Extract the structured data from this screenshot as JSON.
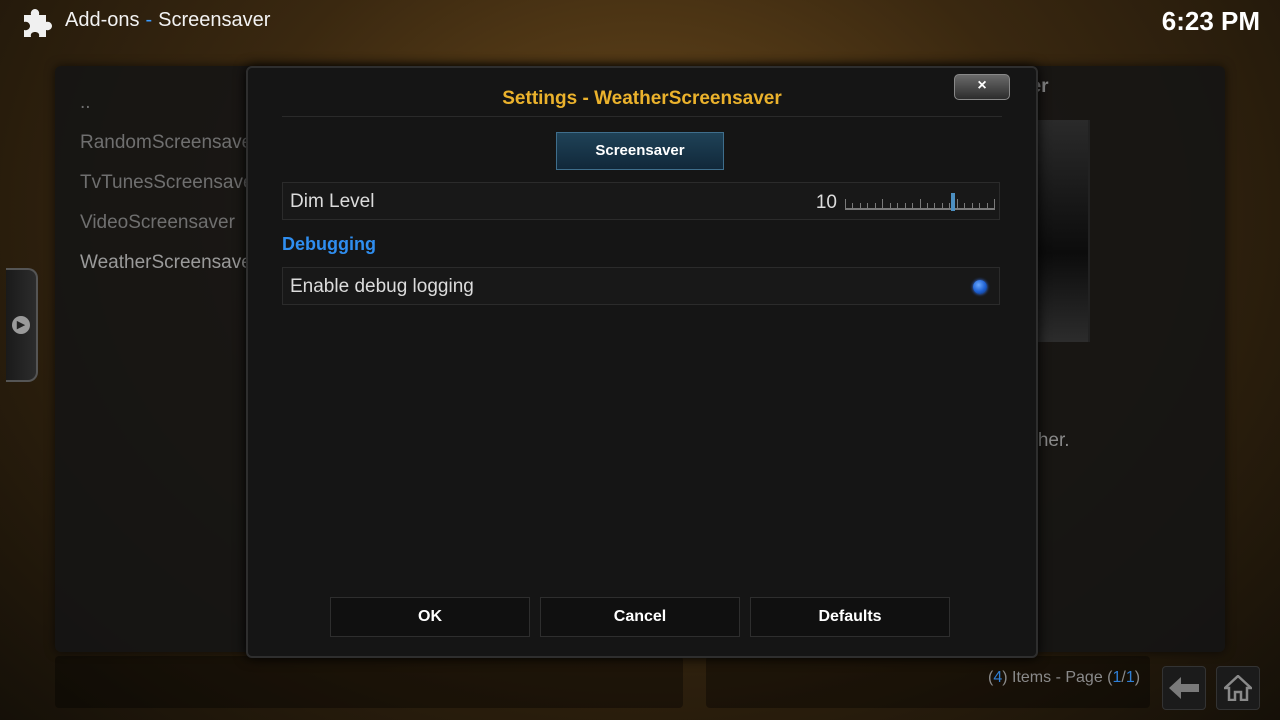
{
  "header": {
    "section": "Add-ons",
    "separator": "-",
    "subsection": "Screensaver",
    "clock": "6:23 PM"
  },
  "background": {
    "list_items": [
      "..",
      "RandomScreensaver",
      "TvTunesScreensaver",
      "VideoScreensaver",
      "WeatherScreensaver"
    ],
    "right_title": "ver",
    "description": "ather."
  },
  "footer": {
    "items_prefix": "(",
    "items_count": "4",
    "items_mid": ") Items - Page (",
    "page_current": "1",
    "page_sep": "/",
    "page_total": "1",
    "items_suffix": ")"
  },
  "dialog": {
    "title": "Settings - WeatherScreensaver",
    "close_label": "×",
    "category": "Screensaver",
    "dim_level_label": "Dim Level",
    "dim_level_value": "10",
    "dim_level_fraction": 0.72,
    "debug_section": "Debugging",
    "debug_label": "Enable debug logging",
    "debug_enabled": true,
    "buttons": {
      "ok": "OK",
      "cancel": "Cancel",
      "defaults": "Defaults"
    }
  },
  "icons": {
    "addon": "puzzle-icon",
    "sidebar_arrow": "chevron-right-icon",
    "back": "back-arrow-icon",
    "home": "home-icon"
  },
  "colors": {
    "title": "#ebb22c",
    "accent": "#2f8ef0",
    "category_bg": "#1f4257"
  }
}
